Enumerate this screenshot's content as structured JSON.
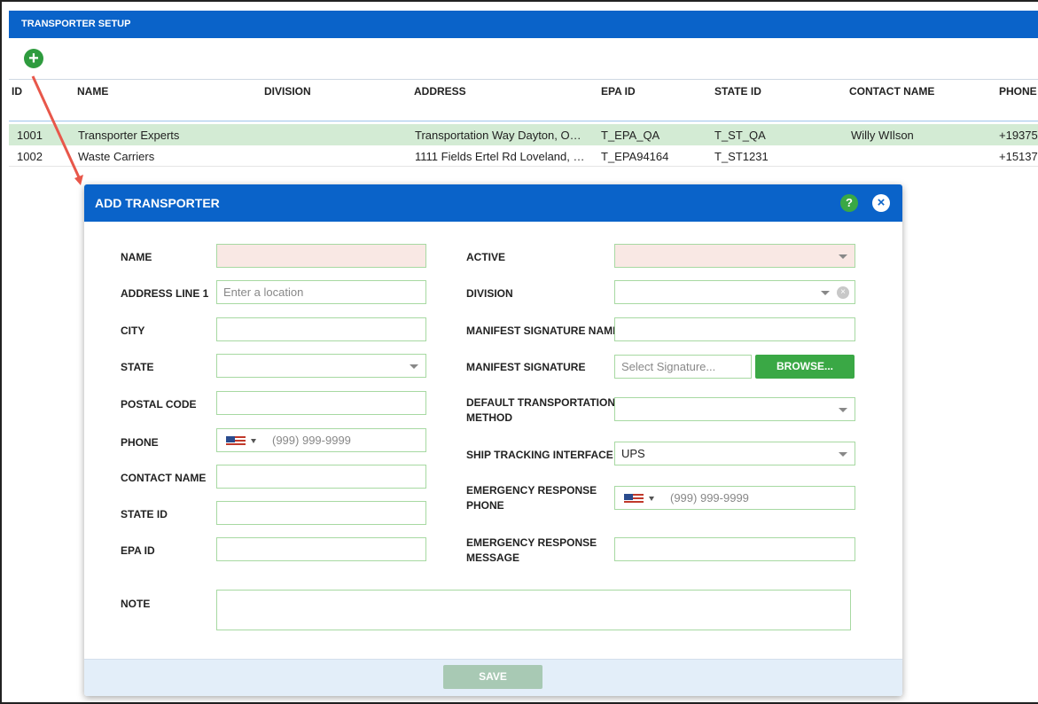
{
  "setup": {
    "title": "TRANSPORTER SETUP",
    "add_icon": "+"
  },
  "grid": {
    "columns": [
      "ID",
      "NAME",
      "DIVISION",
      "ADDRESS",
      "EPA ID",
      "STATE ID",
      "CONTACT NAME",
      "PHONE"
    ],
    "rows": [
      {
        "id": "1001",
        "name": "Transporter Experts",
        "division": "",
        "address": "Transportation Way Dayton, O…",
        "epa_id": "T_EPA_QA",
        "state_id": "T_ST_QA",
        "contact": "Willy WIlson",
        "phone": "+19375"
      },
      {
        "id": "1002",
        "name": "Waste Carriers",
        "division": "",
        "address": "1111 Fields Ertel Rd Loveland, …",
        "epa_id": "T_EPA94164",
        "state_id": "T_ST1231",
        "contact": "",
        "phone": "+15137"
      }
    ],
    "selected_color": "#d3ebd4"
  },
  "modal": {
    "title": "ADD TRANSPORTER",
    "help_icon": "?",
    "close_icon": "×",
    "left": {
      "name": {
        "label": "NAME",
        "value": ""
      },
      "address": {
        "label": "ADDRESS LINE 1",
        "placeholder": "Enter a location"
      },
      "city": {
        "label": "CITY",
        "value": ""
      },
      "state": {
        "label": "STATE",
        "value": ""
      },
      "postal": {
        "label": "POSTAL CODE",
        "value": ""
      },
      "phone": {
        "label": "PHONE",
        "placeholder": "(999) 999-9999"
      },
      "contact": {
        "label": "CONTACT NAME",
        "value": ""
      },
      "state_id": {
        "label": "STATE ID",
        "value": ""
      },
      "epa_id": {
        "label": "EPA ID",
        "value": ""
      }
    },
    "right": {
      "active": {
        "label": "ACTIVE",
        "value": ""
      },
      "division": {
        "label": "DIVISION",
        "value": ""
      },
      "sig_name": {
        "label": "MANIFEST SIGNATURE NAME",
        "value": ""
      },
      "signature": {
        "label": "MANIFEST SIGNATURE",
        "placeholder": "Select Signature...",
        "browse_label": "BROWSE..."
      },
      "transport_method": {
        "label_line1": "DEFAULT TRANSPORTATION",
        "label_line2": "METHOD",
        "value": ""
      },
      "tracking": {
        "label": "SHIP TRACKING INTERFACE",
        "value": "UPS"
      },
      "emergency_phone": {
        "label_line1": "EMERGENCY RESPONSE",
        "label_line2": "PHONE",
        "placeholder": "(999) 999-9999"
      },
      "emergency_msg": {
        "label_line1": "EMERGENCY RESPONSE",
        "label_line2": "MESSAGE",
        "value": ""
      }
    },
    "note": {
      "label": "NOTE",
      "value": ""
    },
    "save_label": "SAVE"
  },
  "colors": {
    "header_blue": "#0a63c9",
    "accent_green": "#3aa845",
    "required_bg": "#f9e8e4",
    "arrow_red": "#e8574a"
  }
}
